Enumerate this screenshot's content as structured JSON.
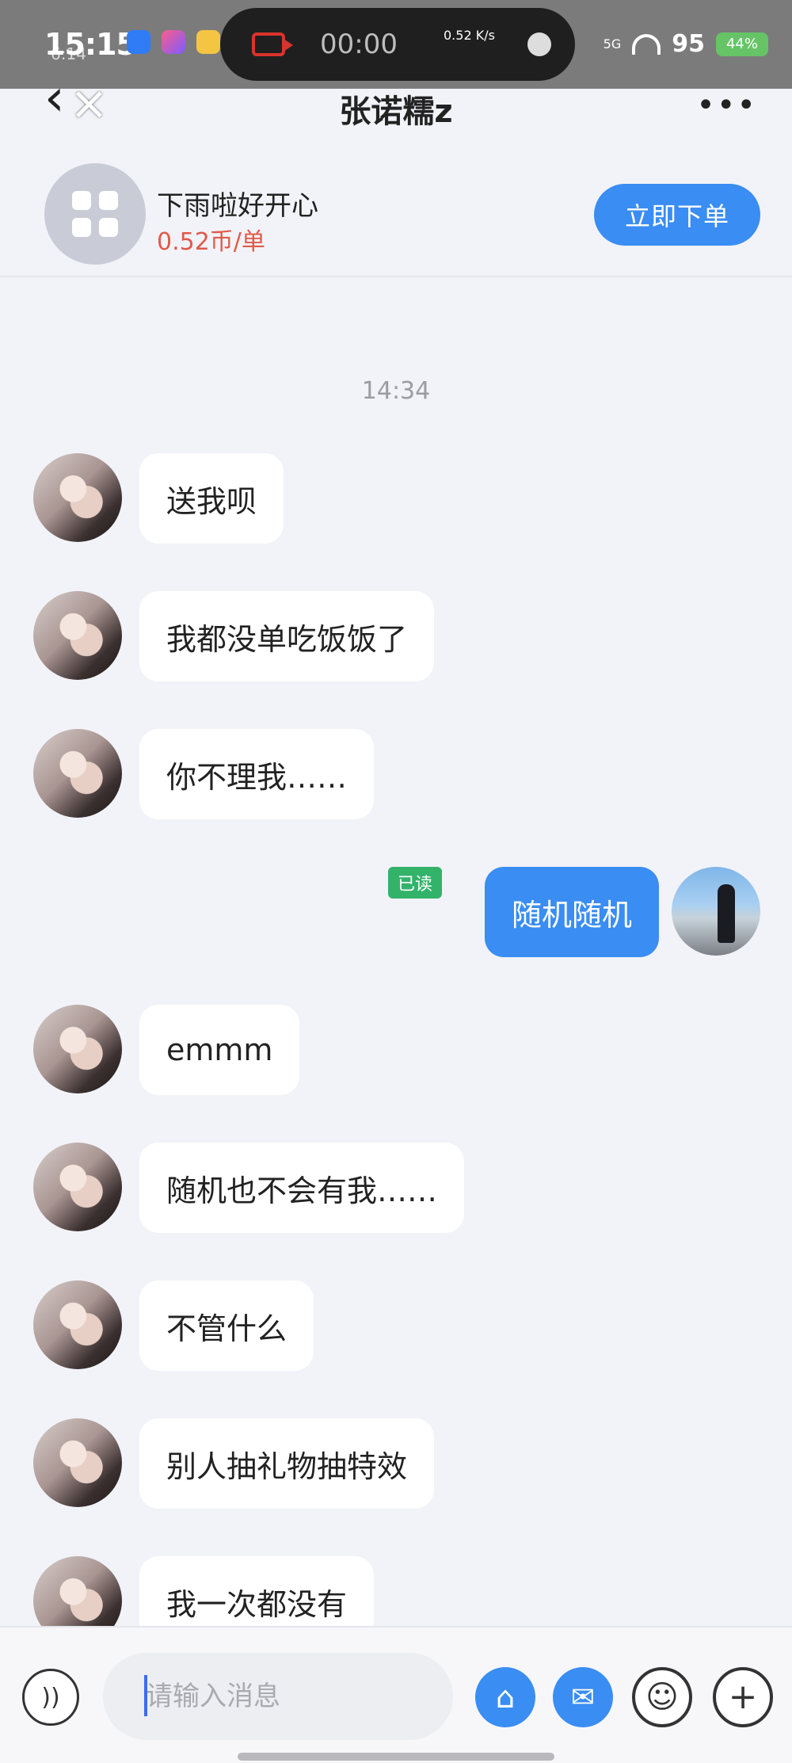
{
  "status_bar": {
    "time": "15:15",
    "time_small": "6:14",
    "recording_timer": "00:00",
    "net_speed": "0.52 K/s",
    "network": "5G",
    "battery_level": "95",
    "battery_small": "44%"
  },
  "header": {
    "title": "张诺糯z"
  },
  "order": {
    "name": "下雨啦好开心",
    "price": "0.52币/单",
    "button_label": "立即下单"
  },
  "chat": {
    "timestamp": "14:34",
    "messages": [
      {
        "sender": "her",
        "text": "送我呗"
      },
      {
        "sender": "her",
        "text": "我都没单吃饭饭了"
      },
      {
        "sender": "her",
        "text": "你不理我……"
      },
      {
        "sender": "me",
        "text": "随机随机",
        "read_label": "已读"
      },
      {
        "sender": "her",
        "text": "emmm"
      },
      {
        "sender": "her",
        "text": "随机也不会有我……"
      },
      {
        "sender": "her",
        "text": "不管什么"
      },
      {
        "sender": "her",
        "text": "别人抽礼物抽特效"
      },
      {
        "sender": "her",
        "text": "我一次都没有"
      }
    ]
  },
  "input_bar": {
    "placeholder": "请输入消息",
    "icons": [
      "voice-icon",
      "gift-icon",
      "red-packet-icon",
      "emoji-icon",
      "plus-icon"
    ]
  },
  "colors": {
    "accent": "#3a8df2",
    "price": "#e05a4b",
    "read_badge": "#33b36a",
    "background": "#f2f3f8"
  }
}
